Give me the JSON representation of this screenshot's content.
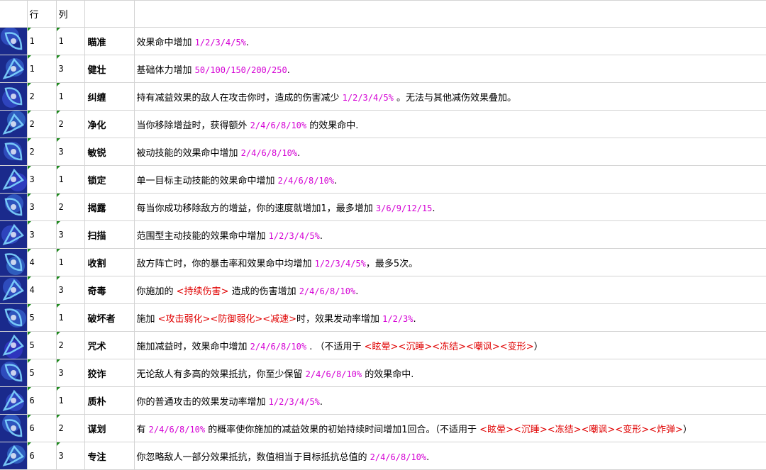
{
  "header": {
    "col_row": "行",
    "col_col": "列"
  },
  "rows": [
    {
      "r": "1",
      "c": "1",
      "name": "瞄准",
      "desc": [
        {
          "t": "效果命中增加 "
        },
        {
          "t": "1/2/3/4/5%",
          "s": "mg"
        },
        {
          "t": "."
        }
      ]
    },
    {
      "r": "1",
      "c": "3",
      "name": "健壮",
      "desc": [
        {
          "t": "基础体力增加 "
        },
        {
          "t": "50/100/150/200/250",
          "s": "mg"
        },
        {
          "t": "."
        }
      ]
    },
    {
      "r": "2",
      "c": "1",
      "name": "纠缠",
      "desc": [
        {
          "t": "持有减益效果的敌人在攻击你时，造成的伤害减少 "
        },
        {
          "t": "1/2/3/4/5%",
          "s": "mg"
        },
        {
          "t": " 。无法与其他减伤效果叠加。"
        }
      ]
    },
    {
      "r": "2",
      "c": "2",
      "name": "净化",
      "desc": [
        {
          "t": "当你移除增益时，获得额外 "
        },
        {
          "t": "2/4/6/8/10%",
          "s": "mg"
        },
        {
          "t": " 的效果命中."
        }
      ]
    },
    {
      "r": "2",
      "c": "3",
      "name": "敏锐",
      "desc": [
        {
          "t": "被动技能的效果命中增加 "
        },
        {
          "t": "2/4/6/8/10%",
          "s": "mg"
        },
        {
          "t": "."
        }
      ]
    },
    {
      "r": "3",
      "c": "1",
      "name": "锁定",
      "desc": [
        {
          "t": "单一目标主动技能的效果命中增加 "
        },
        {
          "t": "2/4/6/8/10%",
          "s": "mg"
        },
        {
          "t": "."
        }
      ]
    },
    {
      "r": "3",
      "c": "2",
      "name": "揭露",
      "desc": [
        {
          "t": "每当你成功移除敌方的增益，你的速度就增加1，最多增加 "
        },
        {
          "t": "3/6/9/12/15",
          "s": "mg"
        },
        {
          "t": "."
        }
      ]
    },
    {
      "r": "3",
      "c": "3",
      "name": "扫描",
      "desc": [
        {
          "t": "范围型主动技能的效果命中增加 "
        },
        {
          "t": "1/2/3/4/5%",
          "s": "mg"
        },
        {
          "t": "."
        }
      ]
    },
    {
      "r": "4",
      "c": "1",
      "name": "收割",
      "desc": [
        {
          "t": "敌方阵亡时，你的暴击率和效果命中均增加 "
        },
        {
          "t": "1/2/3/4/5%",
          "s": "mg"
        },
        {
          "t": "，最多5次。"
        }
      ]
    },
    {
      "r": "4",
      "c": "3",
      "name": "奇毒",
      "desc": [
        {
          "t": "你施加的 "
        },
        {
          "t": "<持续伤害>",
          "s": "rd"
        },
        {
          "t": " 造成的伤害增加 "
        },
        {
          "t": "2/4/6/8/10%",
          "s": "mg"
        },
        {
          "t": "."
        }
      ]
    },
    {
      "r": "5",
      "c": "1",
      "name": "破坏者",
      "desc": [
        {
          "t": "施加 "
        },
        {
          "t": "<攻击弱化><防御弱化><减速>",
          "s": "rd"
        },
        {
          "t": "时，效果发动率增加 "
        },
        {
          "t": "1/2/3%",
          "s": "mg"
        },
        {
          "t": "."
        }
      ]
    },
    {
      "r": "5",
      "c": "2",
      "name": "咒术",
      "desc": [
        {
          "t": "施加减益时，效果命中增加 "
        },
        {
          "t": "2/4/6/8/10%",
          "s": "mg"
        },
        {
          "t": " .  （不适用于 "
        },
        {
          "t": "<眩晕><沉睡><冻结><嘲讽><变形>",
          "s": "rd"
        },
        {
          "t": "）"
        }
      ]
    },
    {
      "r": "5",
      "c": "3",
      "name": "狡诈",
      "desc": [
        {
          "t": "无论敌人有多高的效果抵抗，你至少保留 "
        },
        {
          "t": "2/4/6/8/10%",
          "s": "mg"
        },
        {
          "t": " 的效果命中."
        }
      ]
    },
    {
      "r": "6",
      "c": "1",
      "name": "质朴",
      "desc": [
        {
          "t": "你的普通攻击的效果发动率增加 "
        },
        {
          "t": "1/2/3/4/5%",
          "s": "mg"
        },
        {
          "t": "."
        }
      ]
    },
    {
      "r": "6",
      "c": "2",
      "name": "谋划",
      "desc": [
        {
          "t": "有 "
        },
        {
          "t": "2/4/6/8/10%",
          "s": "mg"
        },
        {
          "t": " 的概率使你施加的减益效果的初始持续时间增加1回合。（不适用于 "
        },
        {
          "t": "<眩晕><沉睡><冻结><嘲讽><变形><炸弹>",
          "s": "rd"
        },
        {
          "t": "）"
        }
      ]
    },
    {
      "r": "6",
      "c": "3",
      "name": "专注",
      "desc": [
        {
          "t": "你忽略敌人一部分效果抵抗，数值相当于目标抵抗总值的 "
        },
        {
          "t": "2/4/6/8/10%",
          "s": "mg"
        },
        {
          "t": "."
        }
      ]
    }
  ],
  "icons": [
    "target-rune-icon",
    "strength-arm-icon",
    "entangle-swirl-icon",
    "purify-blade-icon",
    "keen-eye-icon",
    "lock-on-icon",
    "reveal-eye-icon",
    "scan-beam-icon",
    "harvest-scythe-icon",
    "poison-flask-icon",
    "breaker-hammer-icon",
    "curse-sigil-icon",
    "cunning-dash-icon",
    "plain-strike-icon",
    "scheme-hood-icon",
    "focus-burst-icon"
  ],
  "colors": {
    "accent": "#d400d4",
    "keyword": "#e00000",
    "grid": "#d4d4d4",
    "marker": "#1e8a1e",
    "icon_base": "#1a2a8c",
    "icon_glow": "#7fd6ff"
  }
}
